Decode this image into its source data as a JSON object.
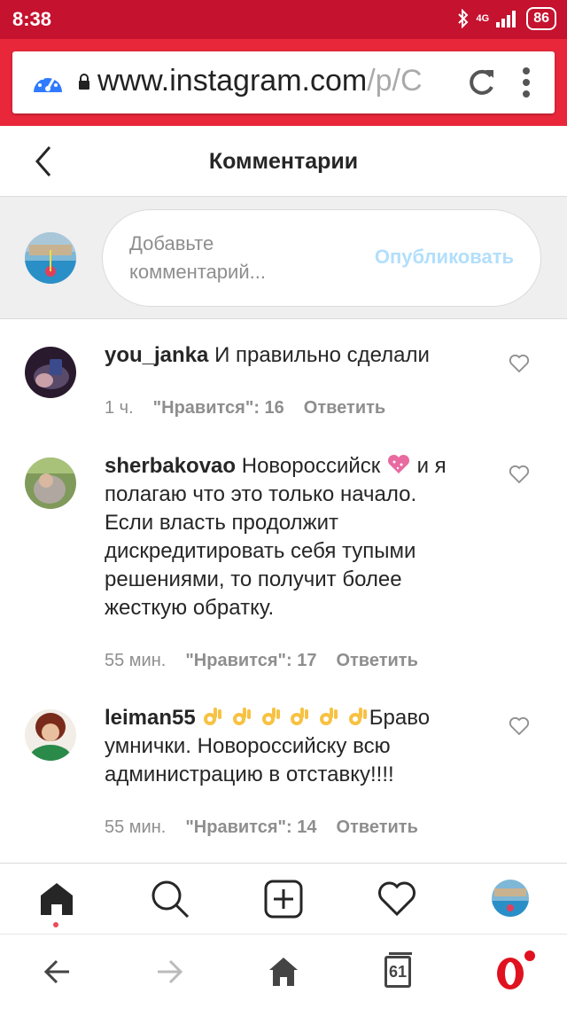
{
  "status": {
    "time": "8:38",
    "network": "4G",
    "battery": "86"
  },
  "browser": {
    "url_main": "www.instagram.com",
    "url_rest": "/p/C"
  },
  "header": {
    "title": "Комментарии"
  },
  "composer": {
    "placeholder": "Добавьте комментарий...",
    "publish_label": "Опубликовать"
  },
  "comments": [
    {
      "user": "you_janka",
      "text": "И правильно сделали",
      "time": "1 ч.",
      "likes": "\"Нравится\": 16",
      "reply": "Ответить"
    },
    {
      "user": "sherbakovao",
      "text_a": "Новороссийск",
      "text_b": "и я полагаю что это только начало. Если власть продолжит дискредитировать себя тупыми решениями, то получит более жесткую обратку.",
      "time": "55 мин.",
      "likes": "\"Нравится\": 17",
      "reply": "Ответить"
    },
    {
      "user": "leiman55",
      "text": "Браво умнички. Новороссийску всю администрацию в отставку!!!!",
      "time": "55 мин.",
      "likes": "\"Нравится\": 14",
      "reply": "Ответить"
    }
  ],
  "android_nav": {
    "tab_count": "61"
  },
  "colors": {
    "status_bar": "#c4122f",
    "browser_bar": "#e8283a",
    "publish_disabled": "#b2dffc",
    "notification_dot": "#ed4956",
    "opera_red": "#e0121f"
  },
  "icons": [
    "speed-dial-icon",
    "lock-icon",
    "reload-icon",
    "menu-dots-icon",
    "back-chevron-icon",
    "heart-icon",
    "home-icon",
    "search-icon",
    "add-post-icon",
    "activity-heart-icon",
    "profile-avatar",
    "back-arrow-icon",
    "forward-arrow-icon",
    "tabs-icon",
    "opera-icon"
  ]
}
